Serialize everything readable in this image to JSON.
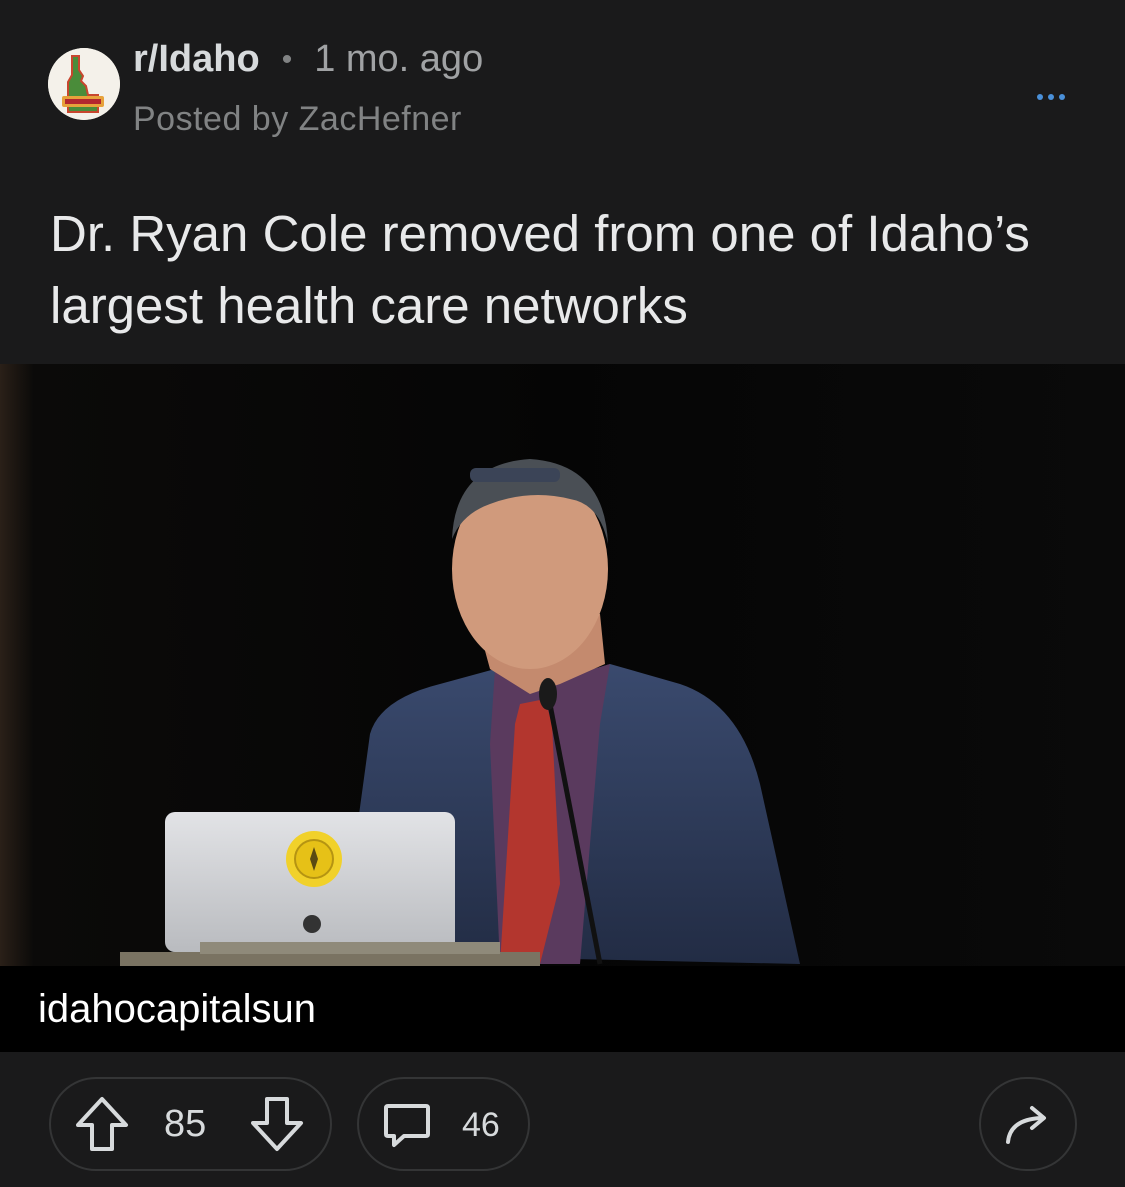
{
  "header": {
    "subreddit": "r/Idaho",
    "separator": "•",
    "age": "1 mo. ago",
    "posted_by": "Posted by ZacHefner",
    "more_icon": "more-horizontal-icon"
  },
  "post": {
    "title": "Dr. Ryan Cole removed from one of Idaho’s largest health care networks",
    "link_domain": "idahocapitalsun",
    "image_icon": "article-thumbnail"
  },
  "actions": {
    "score": "85",
    "comments": "46",
    "upvote_icon": "upvote-arrow-icon",
    "downvote_icon": "downvote-arrow-icon",
    "comment_icon": "comment-bubble-icon",
    "share_icon": "share-arrow-icon"
  },
  "colors": {
    "background": "#1a1a1b",
    "text": "#d7dadc",
    "muted": "#818384",
    "border": "#343536",
    "accent": "#4a90d9"
  }
}
